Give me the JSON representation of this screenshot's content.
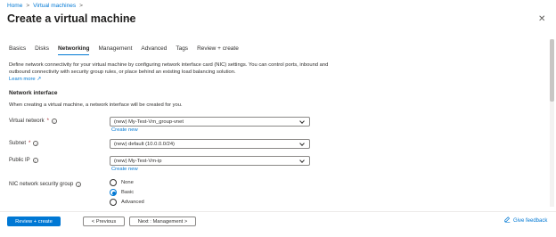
{
  "breadcrumb": {
    "home": "Home",
    "virtual_machines": "Virtual machines",
    "sep": ">"
  },
  "header": {
    "title": "Create a virtual machine",
    "more": "···",
    "close": "✕"
  },
  "tabs": [
    {
      "label": "Basics"
    },
    {
      "label": "Disks"
    },
    {
      "label": "Networking"
    },
    {
      "label": "Management"
    },
    {
      "label": "Advanced"
    },
    {
      "label": "Tags"
    },
    {
      "label": "Review + create"
    }
  ],
  "intro": {
    "text": "Define network connectivity for your virtual machine by configuring network interface card (NIC) settings. You can control ports, inbound and outbound connectivity with security group rules, or place behind an existing load balancing solution.",
    "learn_more": "Learn more ↗"
  },
  "network_interface": {
    "title": "Network interface",
    "description": "When creating a virtual machine, a network interface will be created for you."
  },
  "fields": {
    "virtual_network": {
      "label": "Virtual network",
      "value": "(new) My-Test-Vm_group-vnet",
      "create_new": "Create new"
    },
    "subnet": {
      "label": "Subnet",
      "value": "(new) default (10.0.0.0/24)"
    },
    "public_ip": {
      "label": "Public IP",
      "value": "(new) My-Test-Vm-ip",
      "create_new": "Create new"
    },
    "nsg": {
      "label": "NIC network security group",
      "options": [
        "None",
        "Basic",
        "Advanced"
      ],
      "selected": "Basic"
    }
  },
  "footer": {
    "review_create": "Review + create",
    "previous": "< Previous",
    "next": "Next : Management >",
    "feedback": "Give feedback"
  },
  "colors": {
    "accent": "#0078d4",
    "required": "#a4262c"
  }
}
